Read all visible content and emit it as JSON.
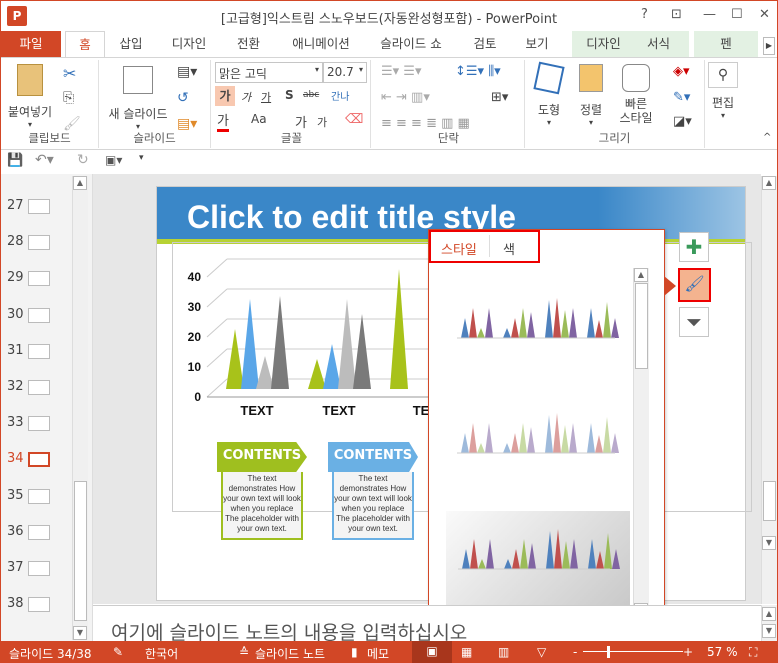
{
  "window": {
    "title": "[고급형]익스트림 스노우보드(자동완성형포함) - PowerPoint",
    "logo": "P",
    "help": "?",
    "restore_ribbon": "⊡",
    "minimize": "—",
    "maximize": "☐",
    "close": "✕"
  },
  "tabs": [
    "파일",
    "홈",
    "삽입",
    "디자인",
    "전환",
    "애니메이션",
    "슬라이드 쇼",
    "검토",
    "보기",
    "디자인",
    "서식",
    "펜"
  ],
  "ribbon": {
    "clipboard": {
      "label": "클립보드",
      "paste": "붙여넣기"
    },
    "slides": {
      "label": "슬라이드",
      "new_slide": "새 슬라이드"
    },
    "font": {
      "label": "글꼴",
      "font_name": "맑은 고딕",
      "font_size": "20.7",
      "bold": "가",
      "italic": "가",
      "underline": "가",
      "shadow": "S",
      "strike": "abc",
      "spacing": "간나",
      "color": "가",
      "case": "Aa",
      "grow": "가",
      "shrink": "가"
    },
    "paragraph": {
      "label": "단락"
    },
    "drawing": {
      "label": "그리기",
      "shapes": "도형",
      "arrange": "정렬",
      "quick_styles": "빠른\n스타일"
    },
    "editing": {
      "label": "편집"
    }
  },
  "thumbnails": {
    "numbers": [
      "27",
      "28",
      "29",
      "30",
      "31",
      "32",
      "33",
      "34",
      "35",
      "36",
      "37",
      "38"
    ],
    "selected": "34"
  },
  "slide": {
    "title": "Click to edit title style",
    "boxes": [
      {
        "head": "CONTENTS",
        "body": "The text demonstrates How your own text will look when you replace The placeholder with your own text.",
        "color": "#9fbf1f"
      },
      {
        "head": "CONTENTS",
        "body": "The text demonstrates How your own text will look when you replace The placeholder with your own text.",
        "color": "#6ab0e4"
      }
    ]
  },
  "chart_data": {
    "type": "bar",
    "subtype": "3d-cone",
    "categories": [
      "TEXT",
      "TEXT",
      "TE"
    ],
    "yticks": [
      "0",
      "10",
      "20",
      "30",
      "40"
    ],
    "ylim": [
      0,
      40
    ],
    "series": [
      {
        "values": [
          20,
          10,
          40
        ],
        "color": "#a8c21a"
      },
      {
        "values": [
          30,
          15,
          null
        ],
        "color": "#5aa6e8"
      },
      {
        "values": [
          11,
          30,
          null
        ],
        "color": "#bcbcbc"
      },
      {
        "values": [
          31,
          25,
          null
        ],
        "color": "#7a7a7a"
      }
    ]
  },
  "chart_styles_popup": {
    "tabs": [
      "스타일",
      "색"
    ],
    "active_tab": "스타일"
  },
  "side_buttons": {
    "elements": "plus-icon",
    "styles": "brush-icon",
    "filter": "filter-icon"
  },
  "notes": {
    "placeholder": "여기에 슬라이드 노트의 내용을 입력하십시오"
  },
  "status": {
    "slide": "슬라이드 34/38",
    "language": "한국어",
    "notes": "슬라이드 노트",
    "comments": "메모",
    "zoom": "57 %",
    "zoom_value": 57,
    "minus": "-",
    "plus": "+"
  },
  "colors": {
    "accent": "#d24726",
    "title_bg": "#3a87c8"
  }
}
